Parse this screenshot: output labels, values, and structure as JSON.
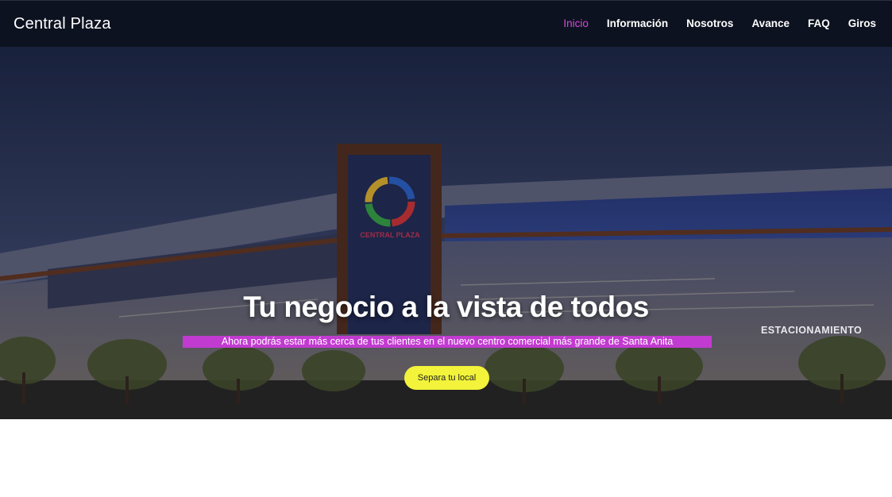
{
  "nav": {
    "brand": "Central Plaza",
    "items": [
      {
        "label": "Inicio",
        "active": true
      },
      {
        "label": "Información",
        "active": false
      },
      {
        "label": "Nosotros",
        "active": false
      },
      {
        "label": "Avance",
        "active": false
      },
      {
        "label": "FAQ",
        "active": false
      },
      {
        "label": "Giros",
        "active": false
      }
    ],
    "active_color": "#d44bd6",
    "background_color": "#0d1220"
  },
  "hero": {
    "title": "Tu negocio a la vista de todos",
    "subtitle": "Ahora podrás estar más cerca de tus clientes en el nuevo centro comercial más grande de Santa Anita",
    "subtitle_highlight_color": "#c23bd0",
    "cta_label": "Separa tu local",
    "cta_color": "#f2f33a",
    "building_sign": "ESTACIONAMIENTO",
    "building_logo": "CENTRAL PLAZA"
  }
}
